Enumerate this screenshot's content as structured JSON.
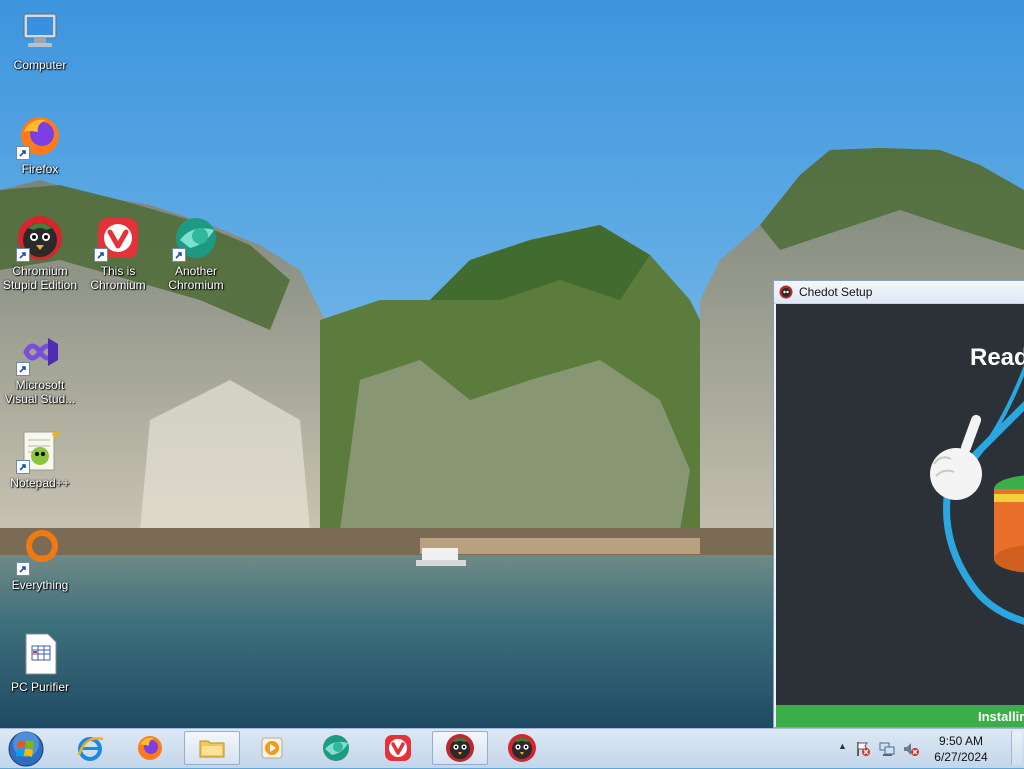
{
  "desktop": {
    "icons": [
      {
        "label": "Computer",
        "icon": "computer-icon"
      },
      {
        "label": "Firefox",
        "icon": "firefox-icon"
      },
      {
        "label": "Chromium Stupid Edition",
        "icon": "chromium-stupid-icon"
      },
      {
        "label": "This is Chromium",
        "icon": "vivaldi-icon"
      },
      {
        "label": "Another Chromium",
        "icon": "another-chromium-icon"
      },
      {
        "label": "Microsoft Visual Stud...",
        "icon": "visual-studio-icon"
      },
      {
        "label": "Notepad++",
        "icon": "notepad-plus-plus-icon"
      },
      {
        "label": "Everything",
        "icon": "everything-search-icon"
      },
      {
        "label": "PC Purifier",
        "icon": "pc-purifier-icon"
      }
    ]
  },
  "setup_window": {
    "title": "Chedot Setup",
    "heading": "Ready",
    "progress_text": "Installing",
    "progress_color": "#3aae49",
    "body_color": "#2b3136"
  },
  "taskbar": {
    "start_label": "Start",
    "pinned": [
      {
        "name": "internet-explorer",
        "icon": "internet-explorer-icon",
        "active": false
      },
      {
        "name": "firefox",
        "icon": "firefox-icon",
        "active": false
      },
      {
        "name": "file-explorer",
        "icon": "folder-icon",
        "active": true
      },
      {
        "name": "media-player",
        "icon": "media-player-icon",
        "active": false
      },
      {
        "name": "another-chromium",
        "icon": "another-chromium-icon",
        "active": false
      },
      {
        "name": "vivaldi",
        "icon": "vivaldi-icon",
        "active": false
      },
      {
        "name": "chedot-setup",
        "icon": "chedot-icon",
        "active": true
      },
      {
        "name": "chromium-stupid",
        "icon": "chromium-stupid-icon",
        "active": false
      }
    ],
    "tray": {
      "time": "9:50 AM",
      "date": "6/27/2024"
    }
  }
}
